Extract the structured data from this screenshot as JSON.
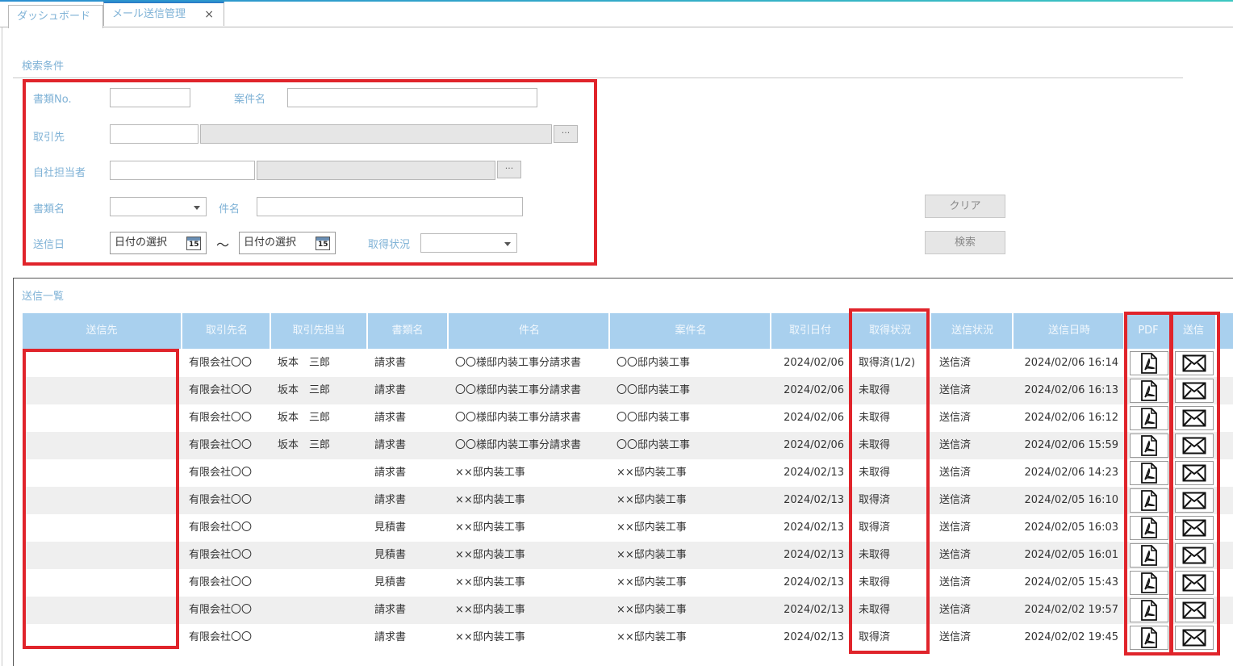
{
  "tabs": [
    {
      "label": "ダッシュボード"
    },
    {
      "label": "メール送信管理",
      "close": "×"
    }
  ],
  "search": {
    "title": "検索条件",
    "doc_no_label": "書類No.",
    "project_label": "案件名",
    "client_label": "取引先",
    "staff_label": "自社担当者",
    "doc_name_label": "書類名",
    "subject_label": "件名",
    "sent_date_label": "送信日",
    "date_from": "日付の選択",
    "date_to": "日付の選択",
    "range_sep": "〜",
    "acquired_label": "取得状況",
    "browse": "···",
    "clear_button": "クリア",
    "search_button": "検索",
    "calendar_day": "15"
  },
  "list": {
    "title": "送信一覧",
    "columns": [
      "送信先",
      "取引先名",
      "取引先担当",
      "書類名",
      "件名",
      "案件名",
      "取引日付",
      "取得状況",
      "送信状況",
      "送信日時",
      "PDF",
      "送信"
    ],
    "rows": [
      {
        "client": "有限会社〇〇",
        "contact": "坂本　三郎",
        "doc": "請求書",
        "subject": "〇〇様邸内装工事分請求書",
        "project": "〇〇邸内装工事",
        "date": "2024/02/06",
        "acquired": "取得済(1/2)",
        "status": "送信済",
        "sent_at": "2024/02/06 16:14"
      },
      {
        "client": "有限会社〇〇",
        "contact": "坂本　三郎",
        "doc": "請求書",
        "subject": "〇〇様邸内装工事分請求書",
        "project": "〇〇邸内装工事",
        "date": "2024/02/06",
        "acquired": "未取得",
        "status": "送信済",
        "sent_at": "2024/02/06 16:13"
      },
      {
        "client": "有限会社〇〇",
        "contact": "坂本　三郎",
        "doc": "請求書",
        "subject": "〇〇様邸内装工事分請求書",
        "project": "〇〇邸内装工事",
        "date": "2024/02/06",
        "acquired": "未取得",
        "status": "送信済",
        "sent_at": "2024/02/06 16:12"
      },
      {
        "client": "有限会社〇〇",
        "contact": "坂本　三郎",
        "doc": "請求書",
        "subject": "〇〇様邸内装工事分請求書",
        "project": "〇〇邸内装工事",
        "date": "2024/02/06",
        "acquired": "未取得",
        "status": "送信済",
        "sent_at": "2024/02/06 15:59"
      },
      {
        "client": "有限会社〇〇",
        "contact": "",
        "doc": "請求書",
        "subject": "××邸内装工事",
        "project": "××邸内装工事",
        "date": "2024/02/13",
        "acquired": "未取得",
        "status": "送信済",
        "sent_at": "2024/02/06 14:23"
      },
      {
        "client": "有限会社〇〇",
        "contact": "",
        "doc": "請求書",
        "subject": "××邸内装工事",
        "project": "××邸内装工事",
        "date": "2024/02/13",
        "acquired": "取得済",
        "status": "送信済",
        "sent_at": "2024/02/05 16:10"
      },
      {
        "client": "有限会社〇〇",
        "contact": "",
        "doc": "見積書",
        "subject": "××邸内装工事",
        "project": "××邸内装工事",
        "date": "2024/02/13",
        "acquired": "取得済",
        "status": "送信済",
        "sent_at": "2024/02/05 16:03"
      },
      {
        "client": "有限会社〇〇",
        "contact": "",
        "doc": "見積書",
        "subject": "××邸内装工事",
        "project": "××邸内装工事",
        "date": "2024/02/13",
        "acquired": "未取得",
        "status": "送信済",
        "sent_at": "2024/02/05 16:01"
      },
      {
        "client": "有限会社〇〇",
        "contact": "",
        "doc": "見積書",
        "subject": "××邸内装工事",
        "project": "××邸内装工事",
        "date": "2024/02/13",
        "acquired": "未取得",
        "status": "送信済",
        "sent_at": "2024/02/05 15:43"
      },
      {
        "client": "有限会社〇〇",
        "contact": "",
        "doc": "請求書",
        "subject": "××邸内装工事",
        "project": "××邸内装工事",
        "date": "2024/02/13",
        "acquired": "未取得",
        "status": "送信済",
        "sent_at": "2024/02/02 19:57"
      },
      {
        "client": "有限会社〇〇",
        "contact": "",
        "doc": "請求書",
        "subject": "××邸内装工事",
        "project": "××邸内装工事",
        "date": "2024/02/13",
        "acquired": "取得済",
        "status": "送信済",
        "sent_at": "2024/02/02 19:45"
      }
    ]
  },
  "icons": {
    "pdf": "pdf-icon",
    "mail": "mail-icon",
    "calendar": "calendar-icon"
  },
  "colors": {
    "highlight": "#e0242b",
    "header": "#a9d0ee",
    "label": "#7fb2d6",
    "accent": "#2a7ec8"
  }
}
